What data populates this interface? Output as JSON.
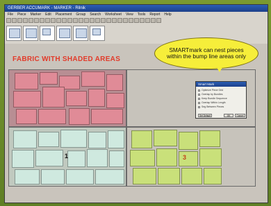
{
  "window": {
    "title": "GERBER ACCUMARK - MARKER - Rilnik"
  },
  "menubar": {
    "items": [
      "File",
      "Piece",
      "Marker",
      "Edit",
      "Placement",
      "Group",
      "Search",
      "Worksheet",
      "View",
      "Tools",
      "Report",
      "Help"
    ]
  },
  "annotation": {
    "heading": "FABRIC WITH SHADED AREAS",
    "bubble": "SMARTmark can nest pieces within the bump line areas only"
  },
  "dialog": {
    "title": "Smart Mark",
    "rows": [
      "Optimize Piece Grid",
      "Overlap by Bundles",
      "Keep Bundle Sequence",
      "Overlap Within Length",
      "Seg Between Pieces"
    ],
    "buttons": {
      "set_default": "Set Default",
      "ok": "OK",
      "cancel": "Cancel"
    }
  },
  "region_markers": {
    "one": "1",
    "three": "3"
  },
  "colors": {
    "pink_pieces": "#e08b97",
    "mint_pieces": "#cfe9df",
    "lime_pieces": "#c9e07a",
    "bubble": "#f6ee3a",
    "heading": "#e23b2a"
  }
}
